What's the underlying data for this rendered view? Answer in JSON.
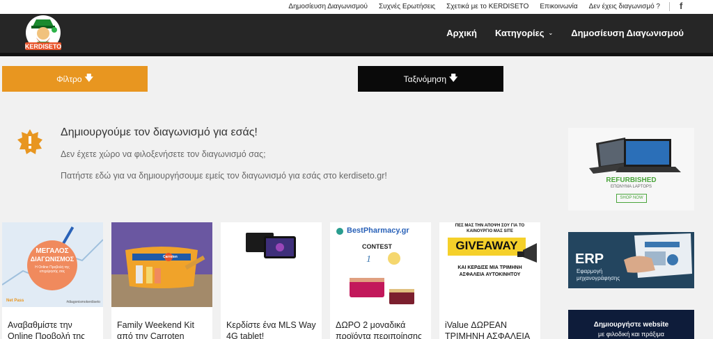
{
  "topbar": {
    "links": [
      "Δημοσίευση Διαγωνισμού",
      "Συχνές Ερωτήσεις",
      "Σχετικά με το KERDISETO",
      "Επικοινωνία",
      "Δεν έχεις διαγωνισμό ?"
    ],
    "facebook": "f"
  },
  "header": {
    "logo_text": "KERDISETO",
    "nav": [
      "Αρχική",
      "Κατηγορίες",
      "Δημοσίευση Διαγωνισμού"
    ],
    "nav_caret": "⌄"
  },
  "controls": {
    "filter_label": "Φίλτρο",
    "sort_label": "Ταξινόμηση",
    "arrow": "🡇"
  },
  "notice": {
    "title": "Δημιουργούμε τον διαγωνισμό για εσάς!",
    "line1": "Δεν έχετε χώρο να φιλοξενήσετε τον διαγωνισμό σας;",
    "line2": "Πατήστε εδώ για να δημιουργήσουμε εμείς τον διαγωνισμό για εσάς στο kerdiseto.gr!"
  },
  "ads": {
    "ad1": {
      "headline": "REFURBISHED",
      "sub": "ΕΠΩΝΥΜΑ LAPTOPS",
      "cta": "SHOP NOW"
    },
    "ad2": {
      "headline": "ERP",
      "sub1": "Εφαρμογή",
      "sub2": "μηχανογράφησης"
    },
    "ad3": {
      "line1": "Δημιουργήστε website",
      "line2": "με φιλοδική και πράξιμα"
    }
  },
  "cards": [
    {
      "title": "Αναβαθμίστε την Online Προβολή της",
      "thumb": {
        "badge_l1": "ΜΕΓΑΛΟΣ",
        "badge_l2": "ΔΙΑΓΩΝΙΣΜΟΣ",
        "badge_small": "Η Online Προβολή της επιχείρησής σας",
        "corner": "Net Pass",
        "hashtag": "#diagonismokerdiseto"
      }
    },
    {
      "title": "Family Weekend Kit από την Carroten",
      "thumb": {
        "label": "Carroten"
      }
    },
    {
      "title": "Κερδίστε ένα MLS Way 4G tablet!",
      "thumb": {}
    },
    {
      "title": "ΔΩΡΟ 2 μοναδικά προϊόντα περιποίησης",
      "thumb": {
        "brand": "BestPharmacy.gr",
        "contest": "CONTEST"
      }
    },
    {
      "title": "iValue ΔΩΡΕΑΝ ΤΡΙΜΗΝΗ ΑΣΦΑΛΕΙΑ",
      "thumb": {
        "top1": "ΠΕΣ ΜΑΣ ΤΗΝ ΑΠΟΨΗ ΣΟΥ ΓΙΑ ΤΟ",
        "top2": "ΚΑΙΝΟΥΡΓΙΟ ΜΑΣ SITE",
        "giveaway": "GIVEAWAY",
        "bottom1": "ΚΑΙ ΚΕΡΔΙΣΕ ΜΙΑ ΤΡΙΜΗΝΗ",
        "bottom2": "ΑΣΦΑΛΕΙΑ ΑΥΤΟΚΙΝΗΤΟΥ"
      }
    }
  ],
  "colors": {
    "accent": "#e89620",
    "header": "#262626",
    "dark_button": "#0a0a0a"
  }
}
